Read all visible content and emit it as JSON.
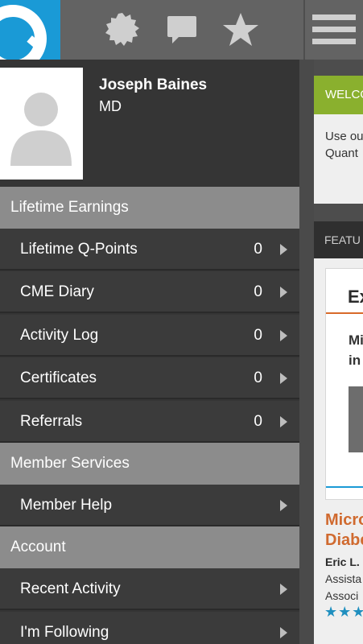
{
  "topbar": {
    "icons": [
      "q-logo-icon",
      "badge-icon",
      "chat-icon",
      "star-icon",
      "menu-icon"
    ]
  },
  "profile": {
    "name": "Joseph Baines",
    "title": "MD"
  },
  "sections": {
    "lifetime_earnings": "Lifetime Earnings",
    "member_services": "Member Services",
    "account": "Account"
  },
  "items": {
    "q_points": {
      "label": "Lifetime Q-Points",
      "count": "0"
    },
    "cme_diary": {
      "label": "CME Diary",
      "count": "0"
    },
    "activity_log": {
      "label": "Activity Log",
      "count": "0"
    },
    "certificates": {
      "label": "Certificates",
      "count": "0"
    },
    "referrals": {
      "label": "Referrals",
      "count": "0"
    },
    "member_help": {
      "label": "Member Help"
    },
    "recent_activity": {
      "label": "Recent Activity"
    },
    "following": {
      "label": "I'm Following"
    }
  },
  "background": {
    "welcome_header": "WELCO",
    "welcome_line1": "Use ou",
    "welcome_line2": "Quant",
    "featured_header": "FEATU",
    "card_title": "Ex",
    "card_sub1": "Mi",
    "card_sub2": "in",
    "article_title1": "Micro",
    "article_title2": "Diabe",
    "author": "Eric L.",
    "role1": "Assista",
    "role2": "Associ",
    "stars": "★★★"
  },
  "colors": {
    "logo": "#1a9ad6",
    "welcome": "#8ab02e",
    "article_title": "#d06a2f",
    "stars": "#1f8fbf"
  }
}
